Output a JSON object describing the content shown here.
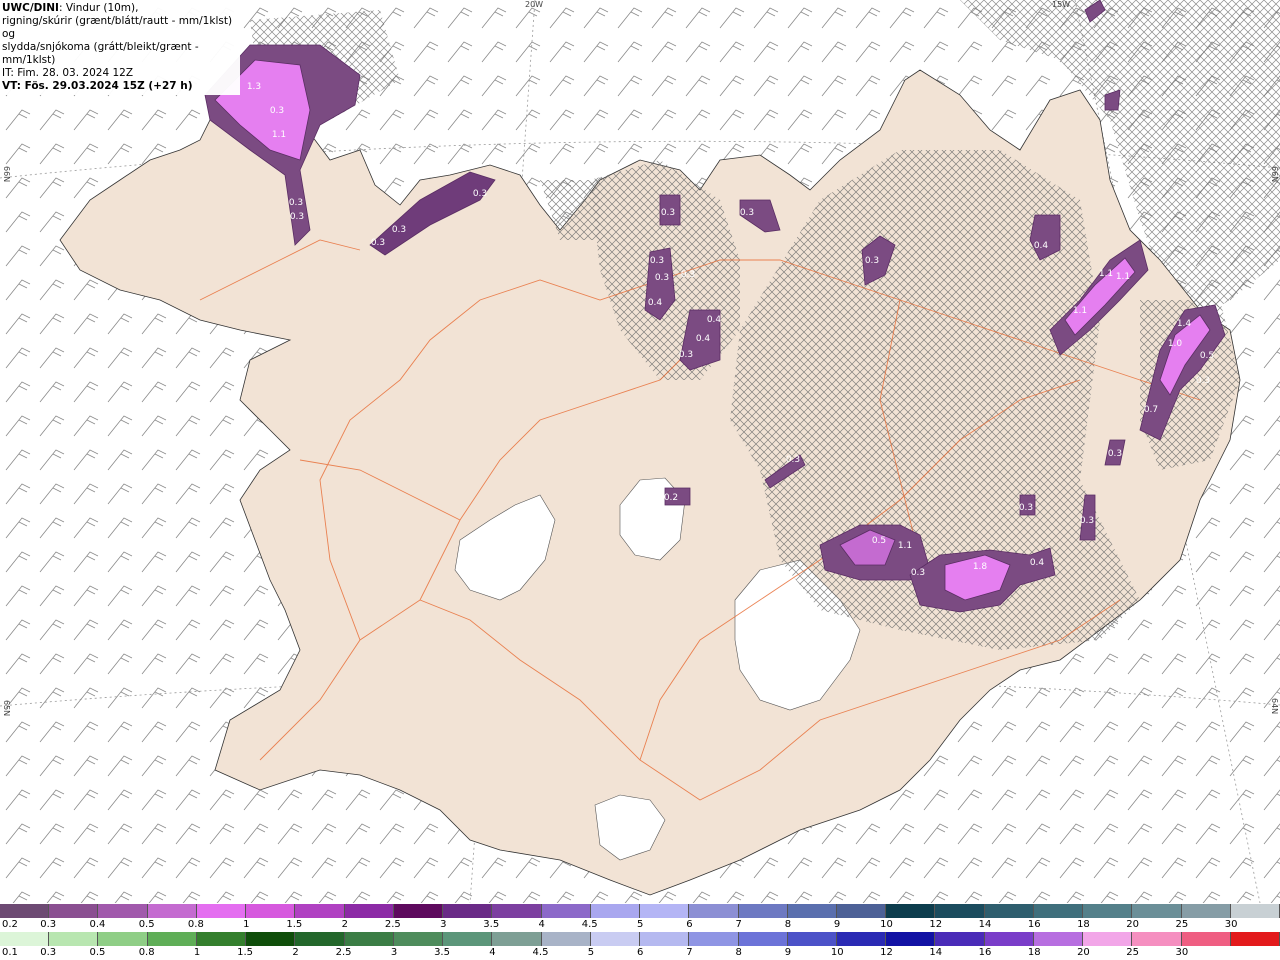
{
  "header": {
    "model": "UWC/DINI",
    "desc_1": ": Vindur (10m),",
    "desc_2": "rigning/skúrir (grænt/blátt/rautt - mm/1klst) og",
    "desc_3": "slydda/snjókoma (grátt/bleikt/grænt - mm/1klst)",
    "init": "IT: Fim. 28. 03. 2024 12Z",
    "valid": "VT: Fös. 29.03.2024 15Z (+27 h)"
  },
  "coords": {
    "lon_20w": "20W",
    "lon_15w": "15W",
    "lat_66n_left": "66N",
    "lat_65n_left": "65N",
    "lat_66n_right": "66N",
    "lat_65n_right": "64N"
  },
  "precip_labels": [
    {
      "id": "p1",
      "text": "1.3"
    },
    {
      "id": "p2",
      "text": "0.3"
    },
    {
      "id": "p3",
      "text": "1.1"
    },
    {
      "id": "p4",
      "text": "0.3"
    },
    {
      "id": "p5",
      "text": "0.3"
    },
    {
      "id": "p6",
      "text": "0.3"
    },
    {
      "id": "p7",
      "text": "0.3"
    },
    {
      "id": "p8",
      "text": "0.3"
    },
    {
      "id": "p9",
      "text": "0.3"
    },
    {
      "id": "p10",
      "text": "0.3"
    },
    {
      "id": "p11",
      "text": "0.3"
    },
    {
      "id": "p12",
      "text": "0.3"
    },
    {
      "id": "p13",
      "text": "0.3"
    },
    {
      "id": "p14",
      "text": "0.4"
    },
    {
      "id": "p15",
      "text": "0.4"
    },
    {
      "id": "p16",
      "text": "0.4"
    },
    {
      "id": "p17",
      "text": "0.3"
    },
    {
      "id": "p18",
      "text": "0.4"
    },
    {
      "id": "p19",
      "text": "0.3"
    },
    {
      "id": "p20",
      "text": "1.1"
    },
    {
      "id": "p21",
      "text": "1.1"
    },
    {
      "id": "p22",
      "text": "1.1"
    },
    {
      "id": "p23",
      "text": "1.4"
    },
    {
      "id": "p24",
      "text": "1.0"
    },
    {
      "id": "p25",
      "text": "0.5"
    },
    {
      "id": "p26",
      "text": "0.3"
    },
    {
      "id": "p27",
      "text": "0.7"
    },
    {
      "id": "p28",
      "text": "0.3"
    },
    {
      "id": "p29",
      "text": "0.2"
    },
    {
      "id": "p30",
      "text": "0.3"
    },
    {
      "id": "p31",
      "text": "0.3"
    },
    {
      "id": "p32",
      "text": "0.5"
    },
    {
      "id": "p33",
      "text": "1.1"
    },
    {
      "id": "p34",
      "text": "0.3"
    },
    {
      "id": "p35",
      "text": "1.8"
    },
    {
      "id": "p36",
      "text": "0.4"
    },
    {
      "id": "p37",
      "text": "0.3"
    }
  ],
  "scale_top": {
    "colors": [
      "#6d4a73",
      "#8a4f91",
      "#a159ac",
      "#c46bd0",
      "#e46ef0",
      "#d659de",
      "#b041c2",
      "#8c2aa6",
      "#5e0a5e",
      "#6a2a87",
      "#7c3fa0",
      "#8c69c9",
      "#a9a7ef",
      "#b4b5f5",
      "#8c8fd4",
      "#6d79c2",
      "#5a6fae",
      "#4d6197",
      "#0d3d4d",
      "#1b4c5e",
      "#2e5e6e",
      "#3f6f7c",
      "#54808a",
      "#6b8f98",
      "#869da6",
      "#c8d0d4"
    ],
    "labels": [
      "0.2",
      "0.3",
      "0.4",
      "0.5",
      "0.8",
      "1",
      "1.5",
      "2",
      "2.5",
      "3",
      "3.5",
      "4",
      "4.5",
      "5",
      "6",
      "7",
      "8",
      "9",
      "10",
      "12",
      "14",
      "16",
      "18",
      "20",
      "25",
      "30"
    ]
  },
  "scale_bottom": {
    "colors": [
      "#dcf5d8",
      "#b8e6b0",
      "#8fce86",
      "#5fae57",
      "#347f2d",
      "#0f4e0a",
      "#23672b",
      "#3b7d45",
      "#4e8c5c",
      "#5c967a",
      "#7e9f95",
      "#a8b3c7",
      "#c9ccf2",
      "#b5b9f0",
      "#8f95e4",
      "#6c73d8",
      "#4c52c8",
      "#2a2ab4",
      "#1212a4",
      "#4a2bb8",
      "#7a3dc9",
      "#b76ee0",
      "#f2a6e8",
      "#f58fc0",
      "#ef5e82",
      "#e31a1c"
    ],
    "labels": [
      "0.1",
      "0.3",
      "0.5",
      "0.8",
      "1",
      "1.5",
      "2",
      "2.5",
      "3",
      "3.5",
      "4",
      "4.5",
      "5",
      "6",
      "7",
      "8",
      "9",
      "10",
      "12",
      "14",
      "16",
      "18",
      "20",
      "25",
      "30"
    ]
  }
}
